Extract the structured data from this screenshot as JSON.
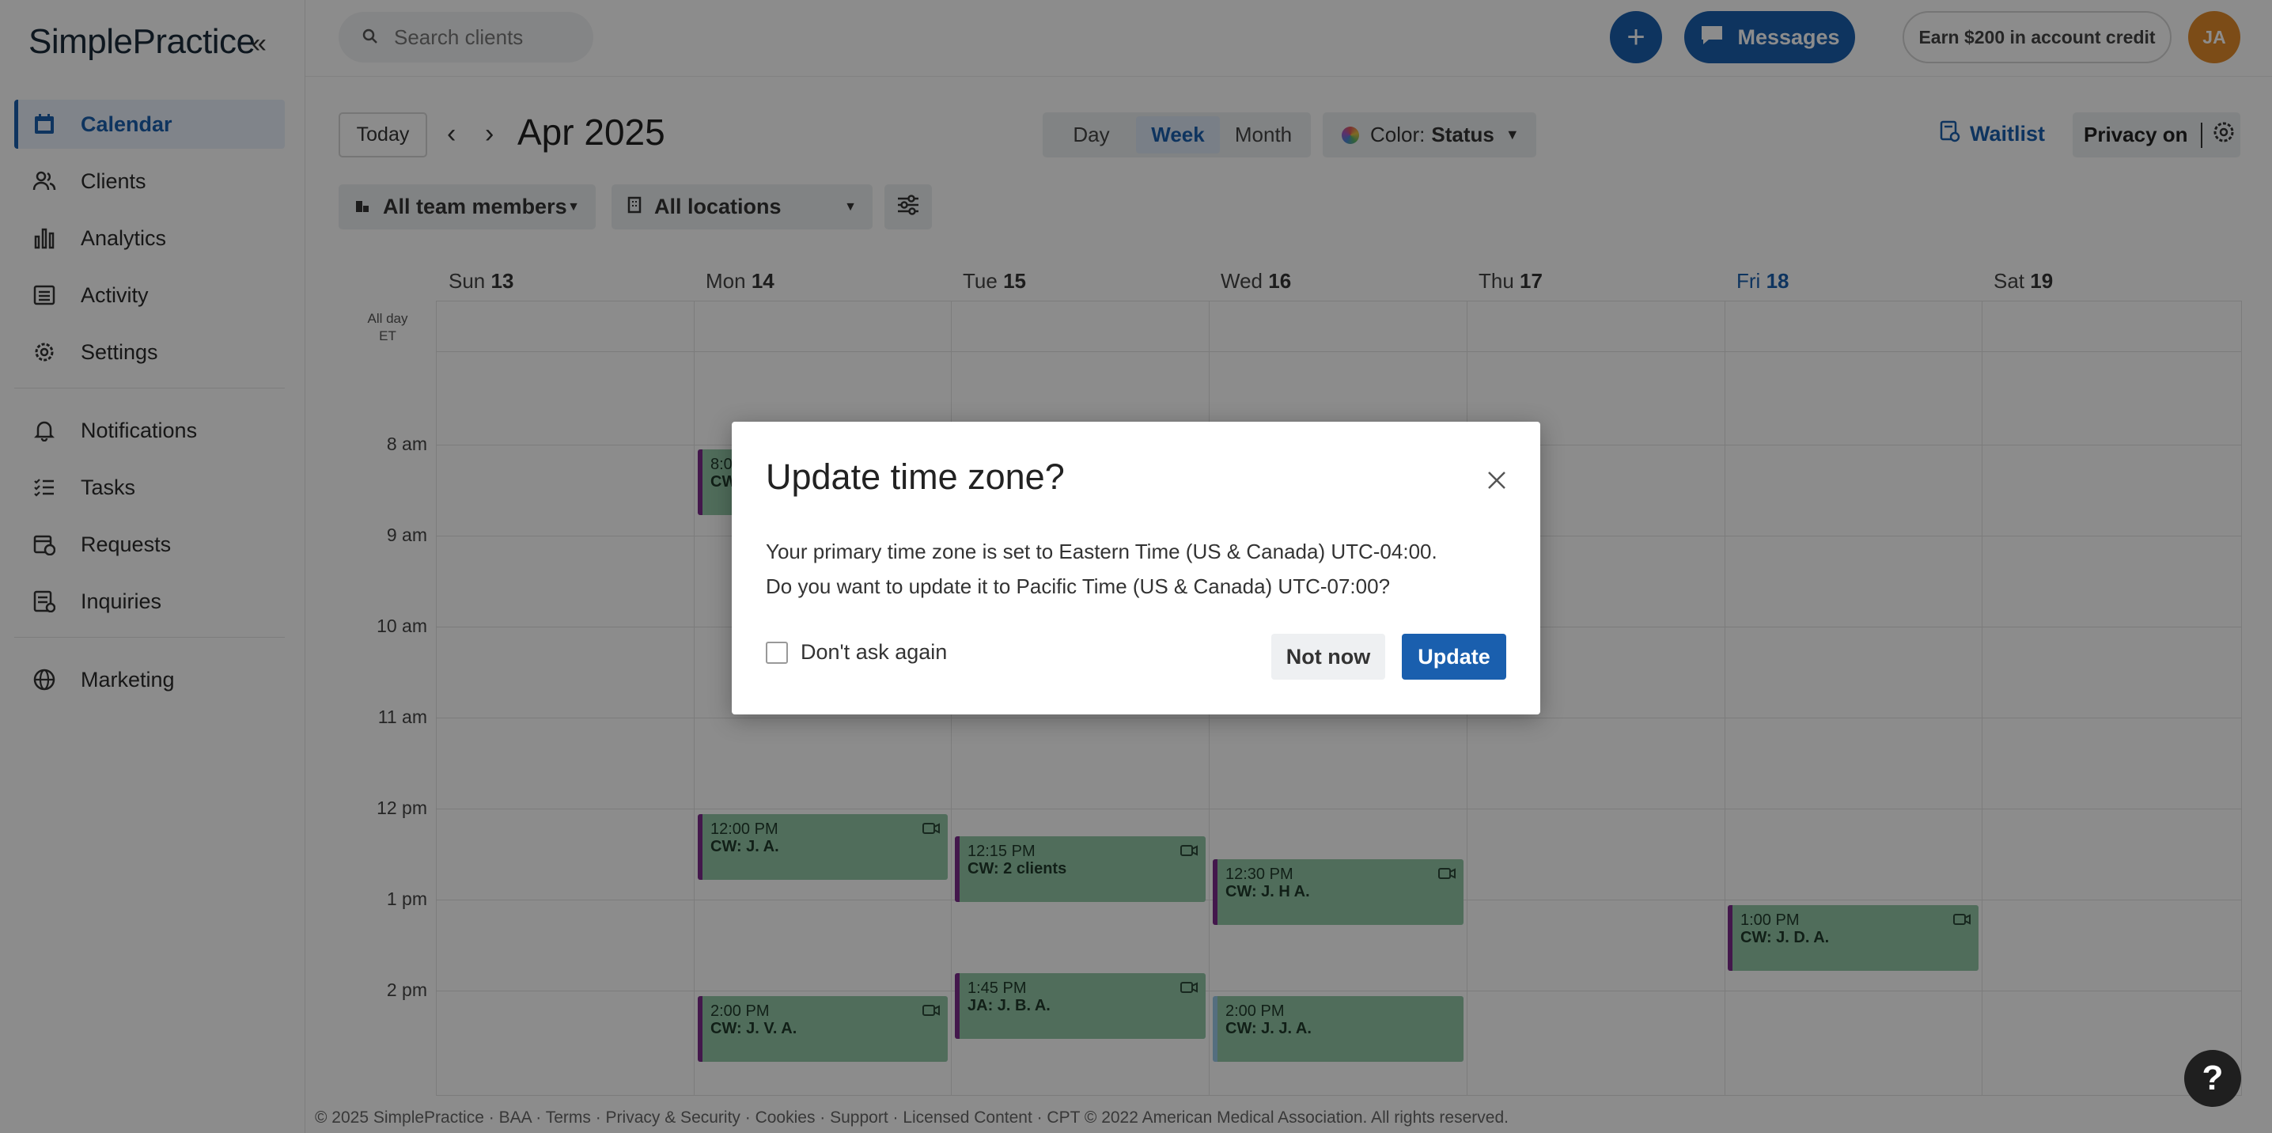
{
  "sidebar": {
    "logo": "SimplePractice",
    "collapse_icon": "double-chevron-left-icon",
    "items": [
      {
        "label": "Calendar",
        "icon": "calendar-icon",
        "active": true
      },
      {
        "label": "Clients",
        "icon": "clients-icon"
      },
      {
        "label": "Analytics",
        "icon": "bar-chart-icon"
      },
      {
        "label": "Activity",
        "icon": "list-icon"
      },
      {
        "label": "Settings",
        "icon": "gear-icon"
      },
      {
        "label": "Notifications",
        "icon": "bell-icon"
      },
      {
        "label": "Tasks",
        "icon": "checklist-icon"
      },
      {
        "label": "Requests",
        "icon": "calendar-plus-icon"
      },
      {
        "label": "Inquiries",
        "icon": "inquiry-icon"
      },
      {
        "label": "Marketing",
        "icon": "globe-icon"
      }
    ]
  },
  "header": {
    "search_placeholder": "Search clients",
    "messages_label": "Messages",
    "earn_label": "Earn $200 in account credit",
    "avatar_initials": "JA"
  },
  "calendar": {
    "today_label": "Today",
    "month_title": "Apr 2025",
    "views": [
      "Day",
      "Week",
      "Month"
    ],
    "active_view": "Week",
    "color_label": "Color:",
    "color_value": "Status",
    "waitlist_label": "Waitlist",
    "privacy_label": "Privacy on",
    "team_filter": "All team members",
    "location_filter": "All locations",
    "days": [
      {
        "name": "Sun",
        "num": "13"
      },
      {
        "name": "Mon",
        "num": "14"
      },
      {
        "name": "Tue",
        "num": "15"
      },
      {
        "name": "Wed",
        "num": "16"
      },
      {
        "name": "Thu",
        "num": "17"
      },
      {
        "name": "Fri",
        "num": "18",
        "today": true
      },
      {
        "name": "Sat",
        "num": "19"
      }
    ],
    "allday_label": "All day",
    "timezone_label": "ET",
    "hours": [
      "8 am",
      "9 am",
      "10 am",
      "11 am",
      "12 pm",
      "1 pm",
      "2 pm"
    ],
    "events": [
      {
        "time": "8:00",
        "who": "CW",
        "day": 1
      },
      {
        "time": "12:00 PM",
        "who": "CW: J. A.",
        "day": 1
      },
      {
        "time": "12:15 PM",
        "who": "CW: 2 clients",
        "day": 2
      },
      {
        "time": "12:30 PM",
        "who": "CW: J. H A.",
        "day": 3
      },
      {
        "time": "1:00 PM",
        "who": "CW: J. D. A.",
        "day": 5
      },
      {
        "time": "1:45 PM",
        "who": "JA: J. B. A.",
        "day": 2
      },
      {
        "time": "2:00 PM",
        "who": "CW: J. V. A.",
        "day": 1
      },
      {
        "time": "2:00 PM",
        "who": "CW: J. J. A.",
        "day": 3
      }
    ]
  },
  "modal": {
    "title": "Update time zone?",
    "line1": "Your primary time zone is set to Eastern Time (US & Canada) UTC-04:00.",
    "line2": "Do you want to update it to Pacific Time (US & Canada) UTC-07:00?",
    "checkbox_label": "Don't ask again",
    "not_now_label": "Not now",
    "update_label": "Update"
  },
  "help_label": "?",
  "footer": "© 2025 SimplePractice · BAA · Terms · Privacy & Security · Cookies · Support · Licensed Content · CPT © 2022 American Medical Association. All rights reserved.",
  "colors": {
    "accent": "#1a5fae",
    "event_bg": "#92c6a7",
    "event_border": "#7a2a8a",
    "avatar": "#e28a2b"
  }
}
